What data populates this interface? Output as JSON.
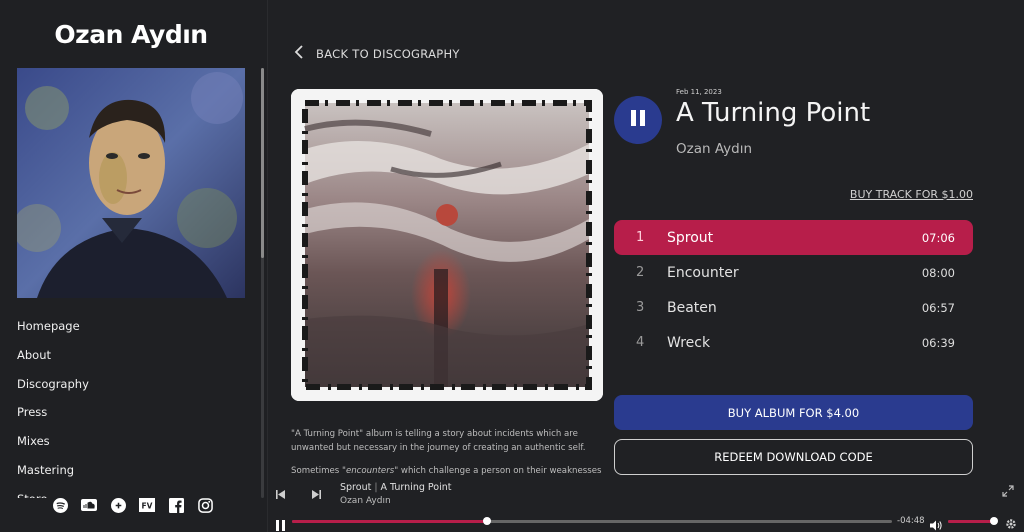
{
  "sidebar": {
    "artist_name": "Ozan Aydın",
    "nav": [
      "Homepage",
      "About",
      "Discography",
      "Press",
      "Mixes",
      "Mastering",
      "Store"
    ],
    "socials": [
      "spotify-icon",
      "soundcloud-icon",
      "apple-music-icon",
      "fv-icon",
      "facebook-icon",
      "instagram-icon"
    ]
  },
  "back": {
    "label": "BACK TO DISCOGRAPHY"
  },
  "release": {
    "date": "Feb 11, 2023",
    "title": "A Turning Point",
    "artist": "Ozan Aydın",
    "buy_track": "BUY TRACK FOR $1.00",
    "buy_album": "BUY ALBUM FOR $4.00",
    "redeem": "REDEEM DOWNLOAD CODE",
    "description": [
      "\"A Turning Point\" album is telling a story about incidents which are unwanted but necessary in the journey of creating an authentic self.",
      "Sometimes \"encounters\" which challenge a person on their weaknesses"
    ],
    "description_emphasis": "encounters",
    "tracks": [
      {
        "num": "1",
        "name": "Sprout",
        "duration": "07:06",
        "active": true
      },
      {
        "num": "2",
        "name": "Encounter",
        "duration": "08:00",
        "active": false
      },
      {
        "num": "3",
        "name": "Beaten",
        "duration": "06:57",
        "active": false
      },
      {
        "num": "4",
        "name": "Wreck",
        "duration": "06:39",
        "active": false
      }
    ]
  },
  "player": {
    "track": "Sprout",
    "separator": "|",
    "album": "A Turning Point",
    "artist": "Ozan Aydın",
    "time_remaining": "-04:48",
    "progress": 0.325,
    "volume": 1.0
  },
  "colors": {
    "accent": "#b71e4a",
    "primary": "#2a3b8f",
    "background": "#202124"
  }
}
